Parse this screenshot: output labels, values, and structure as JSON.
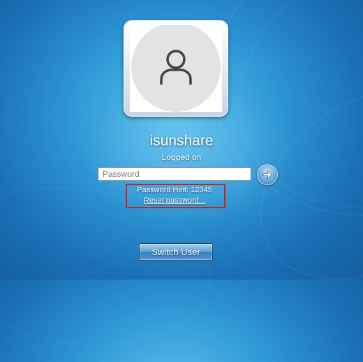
{
  "user": {
    "name": "isunshare",
    "status": "Logged on",
    "avatar_icon": "user-silhouette-icon"
  },
  "password": {
    "placeholder": "Password",
    "value": ""
  },
  "submit": {
    "icon": "arrow-right-icon"
  },
  "hint": {
    "text": "Password Hint: 12345",
    "reset_link": "Reset password..."
  },
  "switch_user_label": "Switch User",
  "colors": {
    "background": "#2f98d6",
    "highlight_box": "#d0201c",
    "text": "#ffffff"
  }
}
